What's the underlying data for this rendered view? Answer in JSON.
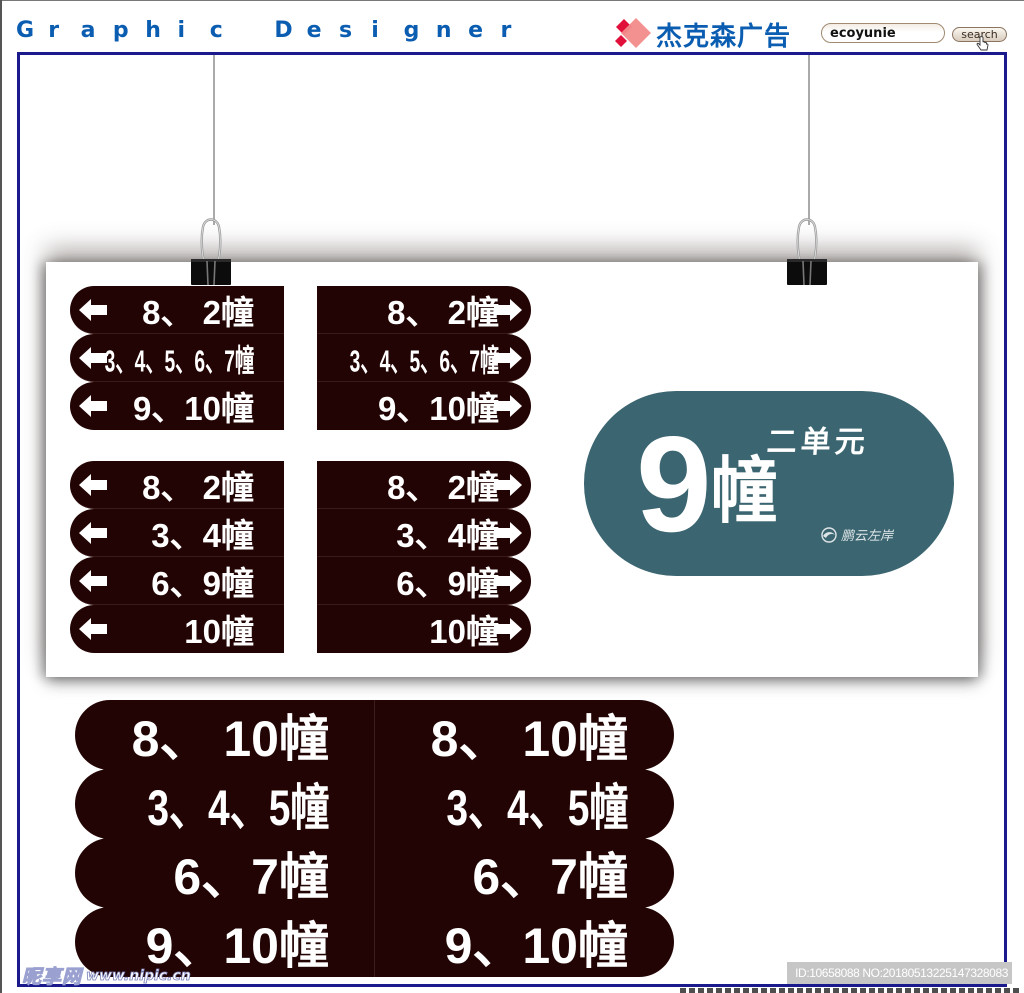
{
  "header": {
    "brand_title": "Graphic Designer",
    "company_name": "杰克森广告",
    "search": {
      "value": "ecoyunie",
      "button_label": "search"
    },
    "colors": {
      "brand_blue": "#0a5db0",
      "logo_red": "#e0103a",
      "logo_pink": "#f28b8b",
      "frame": "#1a1a8c"
    }
  },
  "panel": {
    "small_signs": {
      "group1_left": [
        {
          "text": "8、 2幢",
          "arrow": "left"
        },
        {
          "text": "3、4、5、6、7幢",
          "arrow": "left",
          "condensed": true
        },
        {
          "text": "9、10幢",
          "arrow": "left"
        }
      ],
      "group1_right": [
        {
          "text": "8、 2幢",
          "arrow": "right"
        },
        {
          "text": "3、4、5、6、7幢",
          "arrow": "right",
          "condensed": true
        },
        {
          "text": "9、10幢",
          "arrow": "right"
        }
      ],
      "group2_left": [
        {
          "text": "8、 2幢",
          "arrow": "left"
        },
        {
          "text": "3、4幢",
          "arrow": "left"
        },
        {
          "text": "6、9幢",
          "arrow": "left"
        },
        {
          "text": "10幢",
          "arrow": "left"
        }
      ],
      "group2_right": [
        {
          "text": "8、 2幢",
          "arrow": "right"
        },
        {
          "text": "3、4幢",
          "arrow": "right"
        },
        {
          "text": "6、9幢",
          "arrow": "right"
        },
        {
          "text": "10幢",
          "arrow": "right"
        }
      ],
      "color": "#230404"
    },
    "unit_badge": {
      "building_number": "9",
      "building_suffix": "幢",
      "unit_name": "二单元",
      "brand_name": "鹏云左岸",
      "color": "#3b6570"
    }
  },
  "large_signs": [
    {
      "left": "8、 10幢",
      "right": "8、 10幢"
    },
    {
      "left": "3、4、5幢",
      "right": "3、4、5幢",
      "condensed": true
    },
    {
      "left": "6、7幢",
      "right": "6、7幢"
    },
    {
      "left": "9、10幢",
      "right": "9、10幢"
    }
  ],
  "watermarks": {
    "site_cn": "昵享网",
    "site_url": "www.nipic.cn",
    "image_id": "ID:10658088 NO:20180513225147328083"
  }
}
